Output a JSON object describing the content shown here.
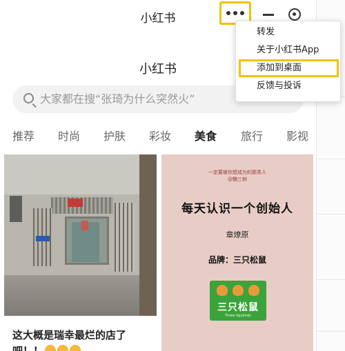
{
  "window": {
    "title": "小红书"
  },
  "menu": {
    "items": [
      {
        "label": "转发",
        "highlighted": false
      },
      {
        "label": "关于小红书App",
        "highlighted": false
      },
      {
        "label": "添加到桌面",
        "highlighted": true
      },
      {
        "label": "反馈与投诉",
        "highlighted": false
      }
    ]
  },
  "app": {
    "title": "小红书"
  },
  "search": {
    "placeholder": "大家都在搜“张琦为什么突然火”"
  },
  "tabs": [
    {
      "label": "推荐",
      "active": false
    },
    {
      "label": "时尚",
      "active": false
    },
    {
      "label": "护肤",
      "active": false
    },
    {
      "label": "彩妆",
      "active": false
    },
    {
      "label": "美食",
      "active": true
    },
    {
      "label": "旅行",
      "active": false
    },
    {
      "label": "影视",
      "active": false
    }
  ],
  "cards": [
    {
      "title_line1": "这大概是瑞幸最烂的店了",
      "title_line2": "吧！！"
    },
    {
      "poster": {
        "subtitle": "一定要被你想成为的那类人",
        "subtitle2": "@糖三树",
        "title": "每天认识一个创始人",
        "author": "章燎原",
        "brand": "品牌：三只松鼠",
        "logo_text": "三只松鼠",
        "logo_en": "Three Squirrels"
      }
    }
  ],
  "colors": {
    "highlight_border": "#f2c200",
    "poster_bg": "#e8cdc7",
    "logo_green": "#3ba33a"
  }
}
